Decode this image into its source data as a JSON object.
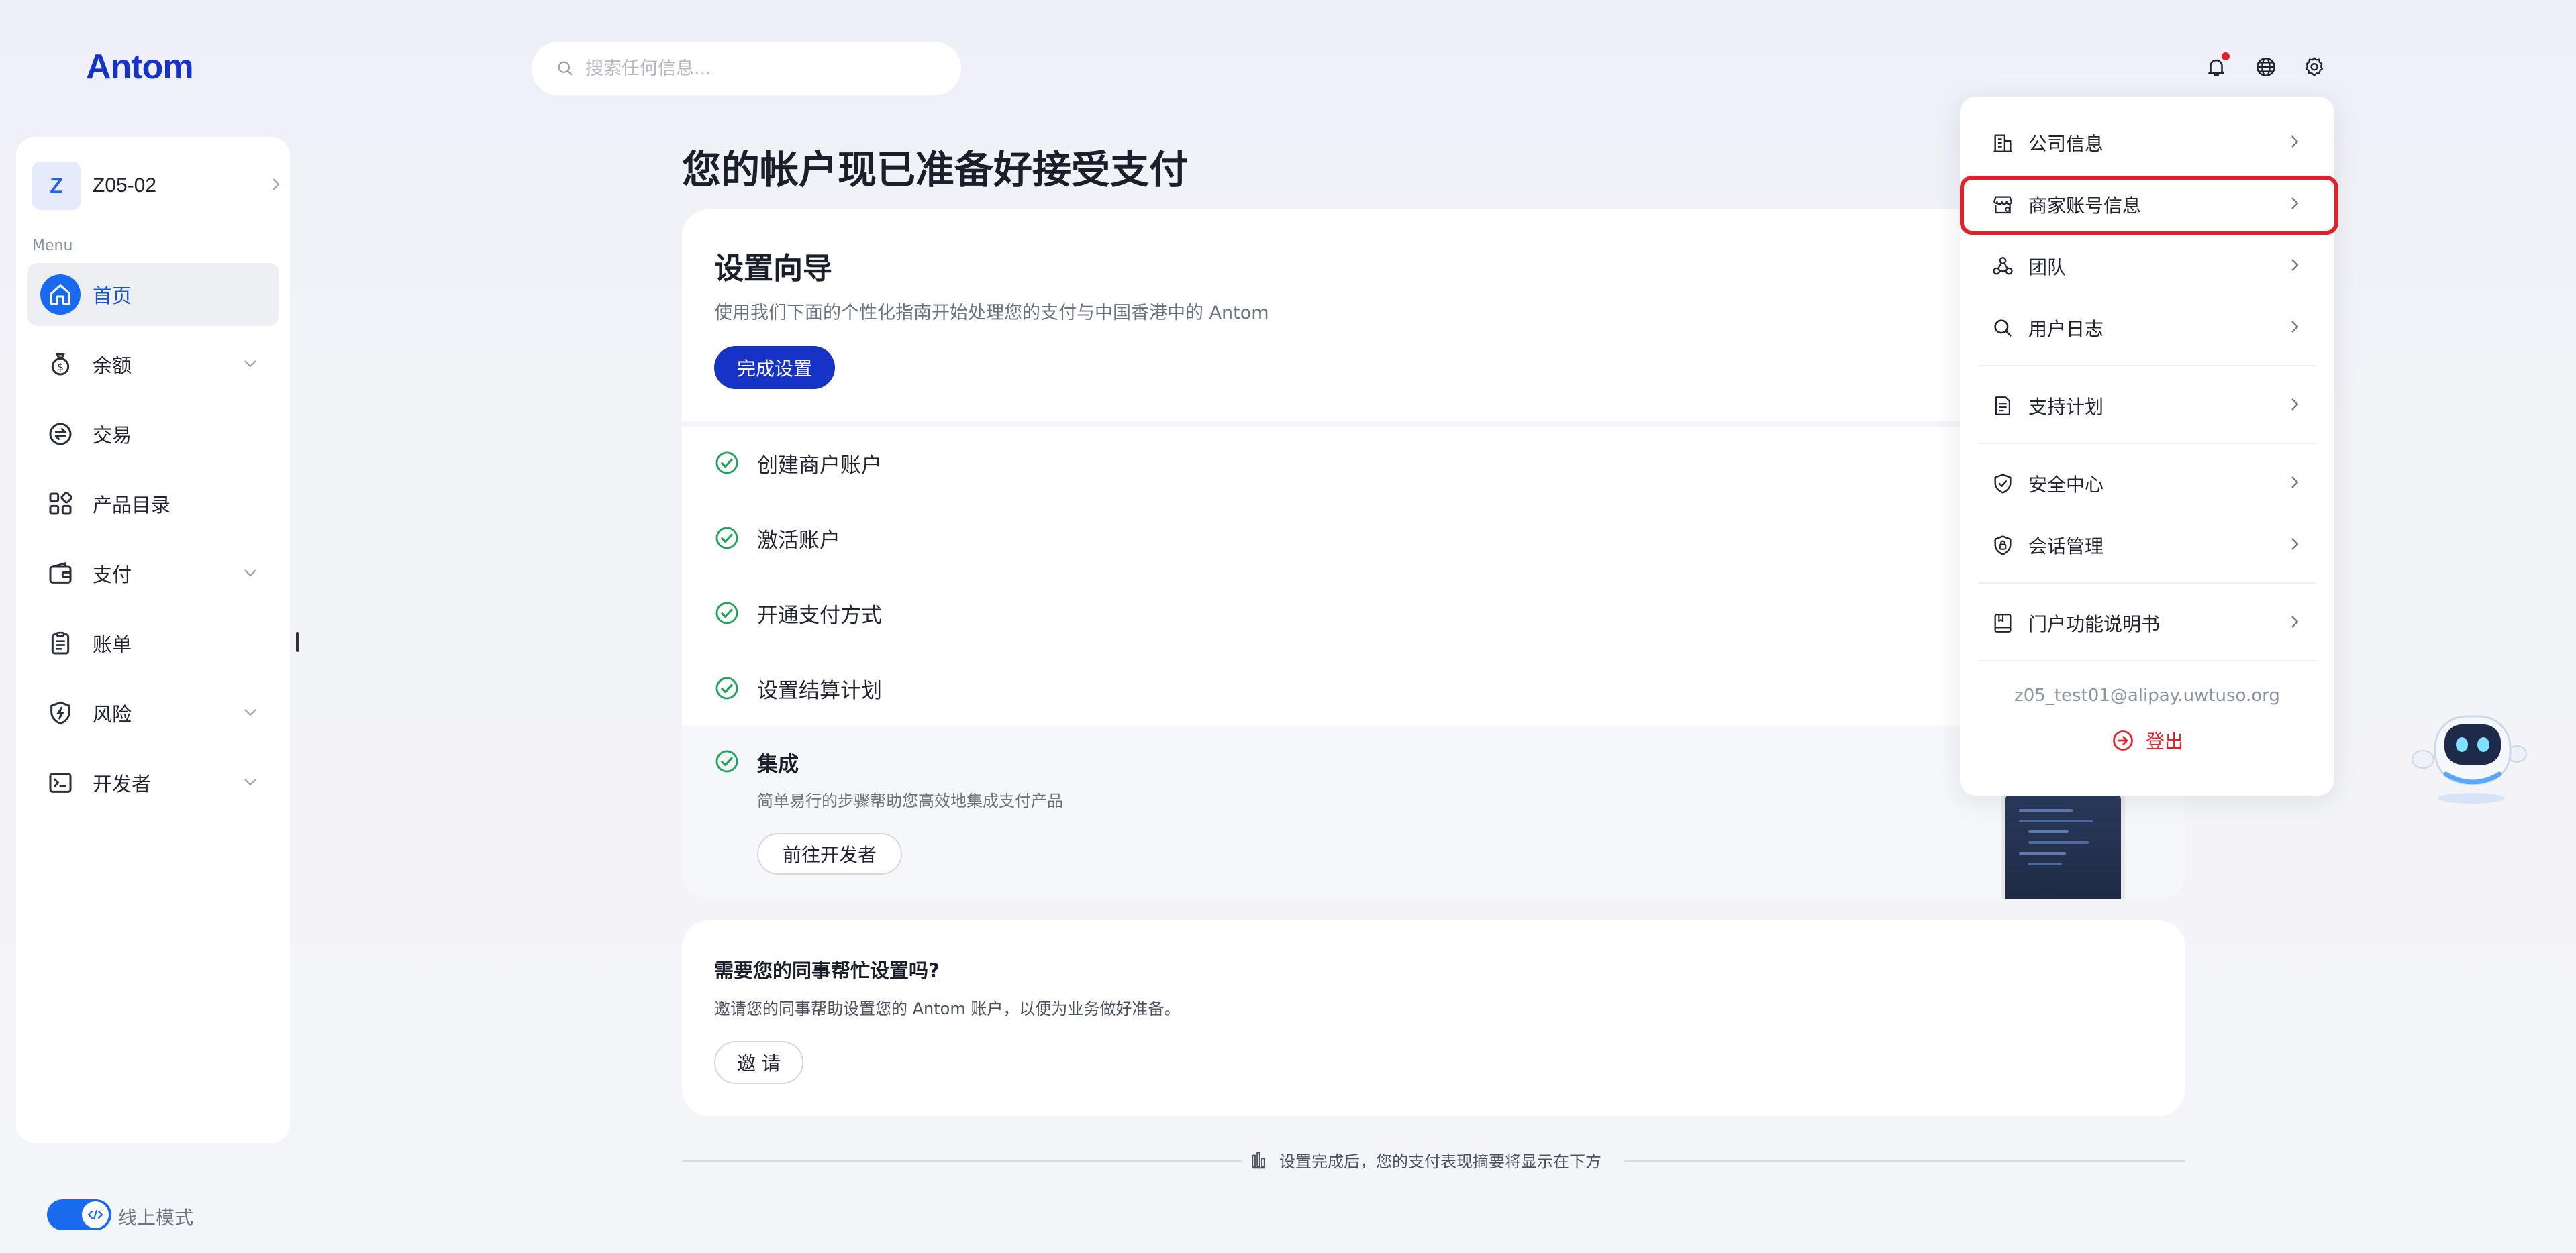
{
  "brand": {
    "logo_text": "Antom",
    "accent": "#1733c7",
    "primary_blue": "#1a6af0"
  },
  "sidebar": {
    "account": {
      "initial": "Z",
      "name": "Z05-02"
    },
    "menu_caption": "Menu",
    "items": [
      {
        "label": "首页",
        "icon": "home-icon",
        "active": true,
        "expandable": false
      },
      {
        "label": "余额",
        "icon": "money-bag-icon",
        "active": false,
        "expandable": true
      },
      {
        "label": "交易",
        "icon": "exchange-icon",
        "active": false,
        "expandable": false
      },
      {
        "label": "产品目录",
        "icon": "grid-icon",
        "active": false,
        "expandable": false
      },
      {
        "label": "支付",
        "icon": "wallet-icon",
        "active": false,
        "expandable": true
      },
      {
        "label": "账单",
        "icon": "clipboard-icon",
        "active": false,
        "expandable": false
      },
      {
        "label": "风险",
        "icon": "shield-bolt-icon",
        "active": false,
        "expandable": true
      },
      {
        "label": "开发者",
        "icon": "terminal-icon",
        "active": false,
        "expandable": true
      }
    ],
    "mode_toggle": {
      "label": "线上模式",
      "on": true
    }
  },
  "search": {
    "placeholder": "搜索任何信息..."
  },
  "main": {
    "title": "您的帐户现已准备好接受支付",
    "setup": {
      "title": "设置向导",
      "description": "使用我们下面的个性化指南开始处理您的支付与中国香港中的 Antom",
      "button": "完成设置",
      "steps": [
        {
          "label": "创建商户账户",
          "done": true
        },
        {
          "label": "激活账户",
          "done": true
        },
        {
          "label": "开通支付方式",
          "done": true
        },
        {
          "label": "设置结算计划",
          "done": true
        }
      ],
      "integration": {
        "title": "集成",
        "description": "简单易行的步骤帮助您高效地集成支付产品",
        "button": "前往开发者",
        "done": true
      }
    },
    "invite": {
      "title": "需要您的同事帮忙设置吗?",
      "description": "邀请您的同事帮助设置您的 Antom 账户，以便为业务做好准备。",
      "button": "邀 请"
    },
    "footer_note": "设置完成后，您的支付表现摘要将显示在下方"
  },
  "dropdown": {
    "items": [
      {
        "label": "公司信息",
        "icon": "company-icon"
      },
      {
        "label": "商家账号信息",
        "icon": "store-icon",
        "highlighted": true
      },
      {
        "label": "团队",
        "icon": "team-icon"
      },
      {
        "label": "用户日志",
        "icon": "search-icon"
      },
      {
        "label": "支持计划",
        "icon": "document-icon"
      },
      {
        "label": "安全中心",
        "icon": "shield-check-icon"
      },
      {
        "label": "会话管理",
        "icon": "shield-lock-icon"
      },
      {
        "label": "门户功能说明书",
        "icon": "book-icon"
      }
    ],
    "email": "z05_test01@alipay.uwtuso.org",
    "logout_label": "登出"
  }
}
